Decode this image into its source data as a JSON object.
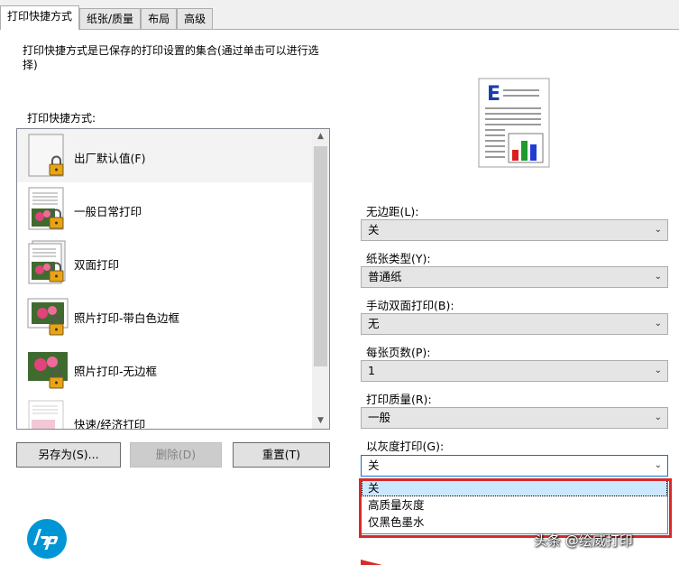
{
  "tabs": [
    {
      "label": "打印快捷方式",
      "active": true
    },
    {
      "label": "纸张/质量",
      "active": false
    },
    {
      "label": "布局",
      "active": false
    },
    {
      "label": "高级",
      "active": false
    }
  ],
  "description": "打印快捷方式是已保存的打印设置的集合(通过单击可以进行选择)",
  "list_label": "打印快捷方式:",
  "shortcuts": [
    {
      "label": "出厂默认值(F)",
      "icon": "blank-page-lock-icon"
    },
    {
      "label": "一般日常打印",
      "icon": "document-photo-lock-icon"
    },
    {
      "label": "双面打印",
      "icon": "duplex-page-lock-icon"
    },
    {
      "label": "照片打印-带白色边框",
      "icon": "photo-border-lock-icon"
    },
    {
      "label": "照片打印-无边框",
      "icon": "photo-borderless-lock-icon"
    },
    {
      "label": "快速/经济打印",
      "icon": "economy-page-icon"
    }
  ],
  "buttons": {
    "save_as": "另存为(S)...",
    "delete": "删除(D)",
    "reset": "重置(T)"
  },
  "fields": {
    "borderless": {
      "label": "无边距(L):",
      "value": "关"
    },
    "paper_type": {
      "label": "纸张类型(Y):",
      "value": "普通纸"
    },
    "manual_duplex": {
      "label": "手动双面打印(B):",
      "value": "无"
    },
    "pages_per_sheet": {
      "label": "每张页数(P):",
      "value": "1"
    },
    "print_quality": {
      "label": "打印质量(R):",
      "value": "一般"
    },
    "grayscale": {
      "label": "以灰度打印(G):",
      "value": "关"
    }
  },
  "grayscale_options": [
    "关",
    "高质量灰度",
    "仅黑色墨水"
  ],
  "watermark": "头条 @绘威打印",
  "colors": {
    "hp_blue": "#0096d6",
    "highlight_red": "#d72a2a",
    "preview_e_blue": "#1a3fa8"
  }
}
